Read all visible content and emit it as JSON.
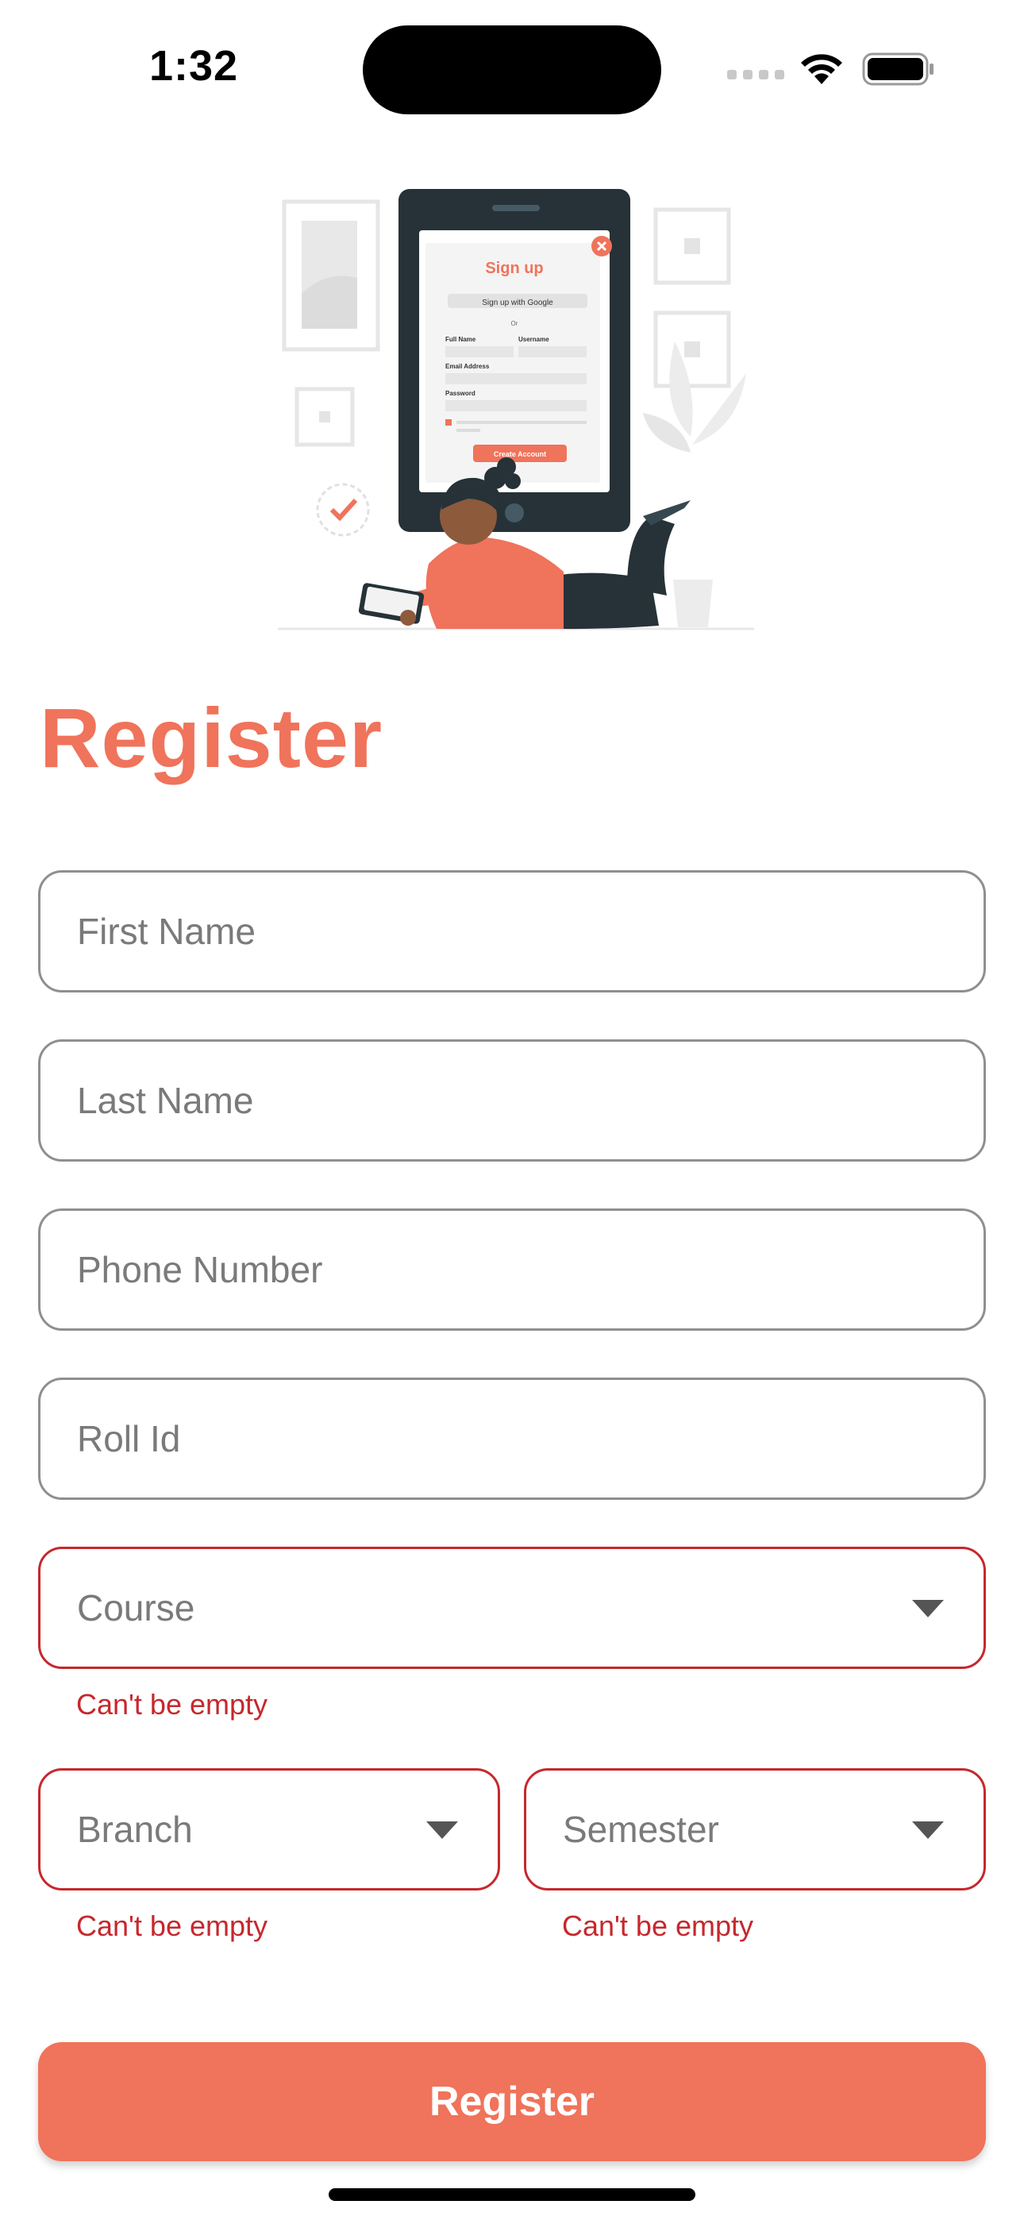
{
  "status_bar": {
    "time": "1:32"
  },
  "illustration": {
    "signup_title": "Sign up",
    "google_label": "Sign up with Google",
    "or_label": "Or",
    "full_name_label": "Full Name",
    "username_label": "Username",
    "email_label": "Email Address",
    "password_label": "Password",
    "create_account_label": "Create Account"
  },
  "page": {
    "title": "Register"
  },
  "form": {
    "first_name": {
      "placeholder": "First Name",
      "value": ""
    },
    "last_name": {
      "placeholder": "Last Name",
      "value": ""
    },
    "phone": {
      "placeholder": "Phone Number",
      "value": ""
    },
    "roll_id": {
      "placeholder": "Roll Id",
      "value": ""
    },
    "course": {
      "label": "Course",
      "error": "Can't be empty"
    },
    "branch": {
      "label": "Branch",
      "error": "Can't be empty"
    },
    "semester": {
      "label": "Semester",
      "error": "Can't be empty"
    }
  },
  "actions": {
    "register_label": "Register"
  },
  "colors": {
    "accent": "#f0735b",
    "error": "#c6282d",
    "border": "#8f8f8f"
  }
}
